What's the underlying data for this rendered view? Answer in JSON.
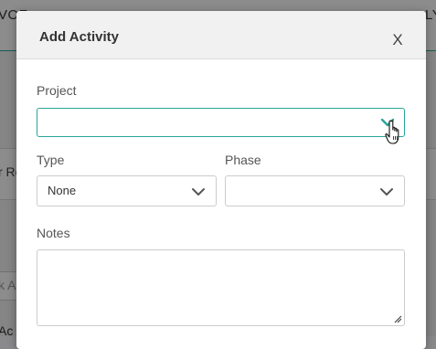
{
  "background": {
    "top_left_text": "VOF",
    "top_right_text": "LY",
    "row_text": "r Ro",
    "input_placeholder": "k Ac",
    "bottom_text": "Ac"
  },
  "modal": {
    "title": "Add Activity",
    "close_label": "X",
    "fields": {
      "project": {
        "label": "Project",
        "value": ""
      },
      "type": {
        "label": "Type",
        "value": "None"
      },
      "phase": {
        "label": "Phase",
        "value": ""
      },
      "notes": {
        "label": "Notes",
        "value": ""
      }
    }
  },
  "icons": {
    "project_chevron": "chevron-down-icon",
    "type_chevron": "chevron-down-icon",
    "phase_chevron": "chevron-down-icon",
    "notes_resize": "resize-handle-icon",
    "cursor": "hand-pointer-cursor"
  },
  "colors": {
    "accent": "#2aa59a",
    "header_bg": "#f1f1f1",
    "border": "#cccccc",
    "label_text": "#555555"
  }
}
